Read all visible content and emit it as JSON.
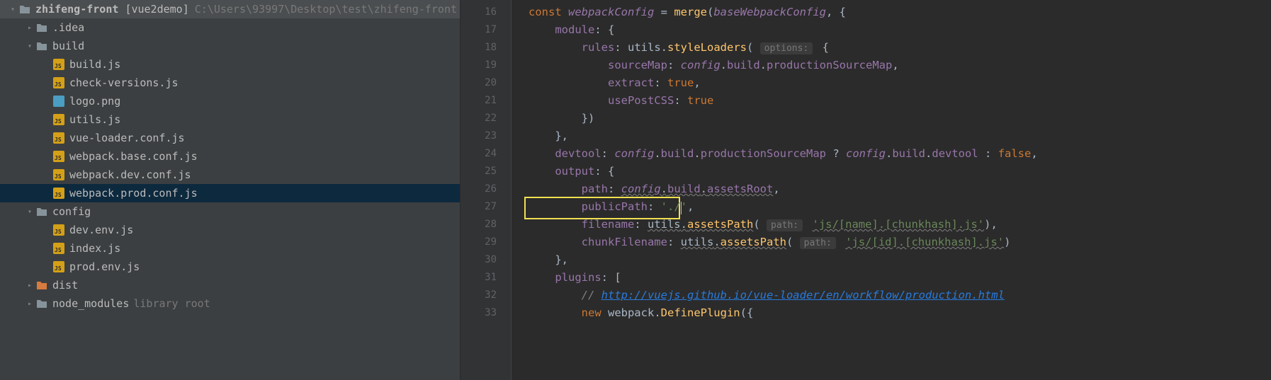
{
  "sidebar": {
    "root": {
      "name": "zhifeng-front",
      "context": "[vue2demo]",
      "path": "C:\\Users\\93997\\Desktop\\test\\zhifeng-front"
    },
    "items": [
      {
        "label": ".idea",
        "type": "folder",
        "collapsed": true,
        "depth": 1
      },
      {
        "label": "build",
        "type": "folder",
        "collapsed": false,
        "depth": 1
      },
      {
        "label": "build.js",
        "type": "js",
        "depth": 2
      },
      {
        "label": "check-versions.js",
        "type": "js",
        "depth": 2
      },
      {
        "label": "logo.png",
        "type": "png",
        "depth": 2
      },
      {
        "label": "utils.js",
        "type": "js",
        "depth": 2
      },
      {
        "label": "vue-loader.conf.js",
        "type": "js",
        "depth": 2
      },
      {
        "label": "webpack.base.conf.js",
        "type": "js",
        "depth": 2
      },
      {
        "label": "webpack.dev.conf.js",
        "type": "js",
        "depth": 2
      },
      {
        "label": "webpack.prod.conf.js",
        "type": "js",
        "depth": 2,
        "selected": true
      },
      {
        "label": "config",
        "type": "folder",
        "collapsed": false,
        "depth": 1
      },
      {
        "label": "dev.env.js",
        "type": "js",
        "depth": 2
      },
      {
        "label": "index.js",
        "type": "js",
        "depth": 2
      },
      {
        "label": "prod.env.js",
        "type": "js",
        "depth": 2
      },
      {
        "label": "dist",
        "type": "folder-orange",
        "collapsed": true,
        "depth": 1
      },
      {
        "label": "node_modules",
        "type": "folder",
        "collapsed": true,
        "depth": 1,
        "suffix": "library root"
      }
    ]
  },
  "editor": {
    "line_numbers": [
      16,
      17,
      18,
      19,
      20,
      21,
      22,
      23,
      24,
      25,
      26,
      27,
      28,
      29,
      30,
      31,
      32,
      33
    ],
    "code": {
      "l16": {
        "kw": "const ",
        "var": "webpackConfig",
        "eq": " = ",
        "fn": "merge",
        "open": "(",
        "arg": "baseWebpackConfig",
        "rest": ", {"
      },
      "l17": {
        "key": "module",
        "rest": ": {"
      },
      "l18": {
        "key": "rules",
        "col": ": ",
        "obj": "utils",
        "dot": ".",
        "fn": "styleLoaders",
        "open": "( ",
        "hint": "options:",
        "rest": " {"
      },
      "l19": {
        "key": "sourceMap",
        "col": ": ",
        "obj": "config",
        "dot1": ".",
        "p1": "build",
        "dot2": ".",
        "p2": "productionSourceMap",
        "end": ","
      },
      "l20": {
        "key": "extract",
        "col": ": ",
        "val": "true",
        "end": ","
      },
      "l21": {
        "key": "usePostCSS",
        "col": ": ",
        "val": "true"
      },
      "l22": {
        "close": "})"
      },
      "l23": {
        "close": "},"
      },
      "l24": {
        "key": "devtool",
        "col": ": ",
        "obj": "config",
        "d1": ".",
        "p1": "build",
        "d2": ".",
        "p2": "productionSourceMap",
        "q": " ? ",
        "obj2": "config",
        "d3": ".",
        "p3": "build",
        "d4": ".",
        "p4": "devtool",
        "colon": " : ",
        "false": "false",
        "end": ","
      },
      "l25": {
        "key": "output",
        "rest": ": {"
      },
      "l26": {
        "key": "path",
        "col": ": ",
        "obj": "config",
        "d1": ".",
        "p1": "build",
        "d2": ".",
        "p2": "assetsRoot",
        "end": ","
      },
      "l27": {
        "key": "publicPath",
        "col": ": ",
        "str1": "'./",
        "str2": "'",
        "end": ","
      },
      "l28": {
        "key": "filename",
        "col": ": ",
        "obj": "utils",
        "dot": ".",
        "fn": "assetsPath",
        "open": "( ",
        "hint": "path:",
        "sp": " ",
        "str": "'js/[name].[chunkhash].js'",
        "close": "),"
      },
      "l29": {
        "key": "chunkFilename",
        "col": ": ",
        "obj": "utils",
        "dot": ".",
        "fn": "assetsPath",
        "open": "( ",
        "hint": "path:",
        "sp": " ",
        "str": "'js/[id].[chunkhash].js'",
        "close": ")"
      },
      "l30": {
        "close": "},"
      },
      "l31": {
        "key": "plugins",
        "rest": ": ["
      },
      "l32": {
        "comment_prefix": "// ",
        "link": "http://vuejs.github.io/vue-loader/en/workflow/production.html"
      },
      "l33": {
        "kw": "new ",
        "obj": "webpack",
        "dot": ".",
        "fn": "DefinePlugin",
        "rest": "({"
      }
    }
  }
}
